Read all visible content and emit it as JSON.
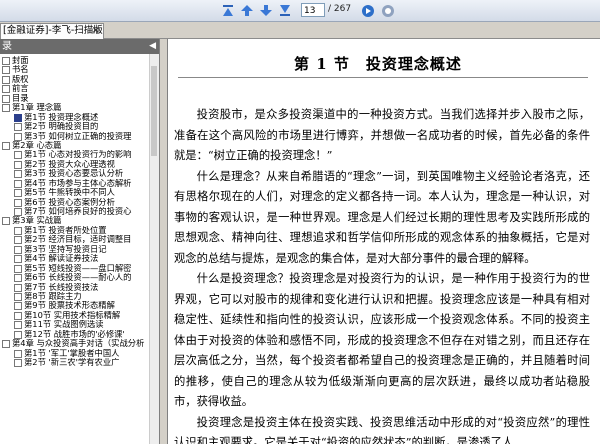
{
  "toolbar": {
    "page_current": "13",
    "page_total": "/ 267"
  },
  "tab": {
    "title": "[金融证券]-李飞-扫描版",
    "close": "×"
  },
  "sidebar": {
    "title": "录",
    "collapse": "◀",
    "items": [
      {
        "text": "封面",
        "level": 0
      },
      {
        "text": "书名",
        "level": 0
      },
      {
        "text": "版权",
        "level": 0
      },
      {
        "text": "前言",
        "level": 0
      },
      {
        "text": "目录",
        "level": 0
      },
      {
        "text": "第1章  理念篇",
        "level": 0
      },
      {
        "text": "第1节  投资理念概述",
        "level": 1,
        "selected": true
      },
      {
        "text": "第2节  明确投资目的",
        "level": 1
      },
      {
        "text": "第3节  如何树立正确的投资理",
        "level": 1
      },
      {
        "text": "第2章  心态篇",
        "level": 0
      },
      {
        "text": "第1节  心态对投资行为的影响",
        "level": 1
      },
      {
        "text": "第2节  投资大众心理透视",
        "level": 1
      },
      {
        "text": "第3节  投资心态要忌认分析",
        "level": 1
      },
      {
        "text": "第4节  市场参与主体心态解析",
        "level": 1
      },
      {
        "text": "第5节  牛熊转换中不同人",
        "level": 1
      },
      {
        "text": "第6节  投资心态案例分析",
        "level": 1
      },
      {
        "text": "第7节  如何培养良好的投资心",
        "level": 1
      },
      {
        "text": "第3章  实战篇",
        "level": 0
      },
      {
        "text": "第1节  投资者所处位置",
        "level": 1
      },
      {
        "text": "第2节  经济目标，适时调整目",
        "level": 1
      },
      {
        "text": "第3节  坚持写投资日记",
        "level": 1
      },
      {
        "text": "第4节  解读证券技法",
        "level": 1
      },
      {
        "text": "第5节  短线投资——盘口解密",
        "level": 1
      },
      {
        "text": "第6节  长线投资——耐心人的",
        "level": 1
      },
      {
        "text": "第7节  长线投资技法",
        "level": 1
      },
      {
        "text": "第8节  跟踪主力",
        "level": 1
      },
      {
        "text": "第9节  股票技术形态精解",
        "level": 1
      },
      {
        "text": "第10节  实用技术指标精解",
        "level": 1
      },
      {
        "text": "第11节  实战图例选读",
        "level": 1
      },
      {
        "text": "第12节  战胜市场的'必修课'",
        "level": 1
      },
      {
        "text": "第4章  与众投资高手对话（实战分析",
        "level": 0
      },
      {
        "text": "第1节  '军工'掌股者中国人",
        "level": 1
      },
      {
        "text": "第2节  '新三农'学有农业广",
        "level": 1
      }
    ]
  },
  "page": {
    "section_title": "第 1 节　投资理念概述",
    "paragraphs": [
      "投资股市，是众多投资渠道中的一种投资方式。当我们选择并步入股市之际，准备在这个高风险的市场里进行博弈，并想做一名成功者的时候，首先必备的条件就是：“树立正确的投资理念！”",
      "什么是理念？从来自希腊语的“理念”一词，到英国唯物主义经验论者洛克，还有思格尔现在的人们，对理念的定义都各持一词。本人认为，理念是一种认识，对事物的客观认识，是一种世界观。理念是人们经过长期的理性思考及实践所形成的思想观念、精神向往、理想追求和哲学信仰所形成的观念体系的抽象概括，它是对观念的总结与提炼，是观念的集合体，是对大部分事件的最合理的解释。",
      "什么是投资理念？投资理念是对投资行为的认识，是一种作用于投资行为的世界观，它可以对股市的规律和变化进行认识和把握。投资理念应该是一种具有相对稳定性、延续性和指向性的投资认识，应该形成一个投资观念体系。不同的投资主体由于对投资的体验和感悟不同，形成的投资理念不但存在对错之别，而且还存在层次高低之分，当然，每个投资者都希望自己的投资理念是正确的，并且随着时间的推移，使自己的理念从较为低级渐渐向更高的层次跃进，最终以成功者站稳股市，获得收益。",
      "投资理念是投资主体在投资实践、投资思维活动中形成的对“投资应然”的理性认识和主观要求。它是关于对“投资的应然状态”的判断，是渗透了人"
    ]
  }
}
